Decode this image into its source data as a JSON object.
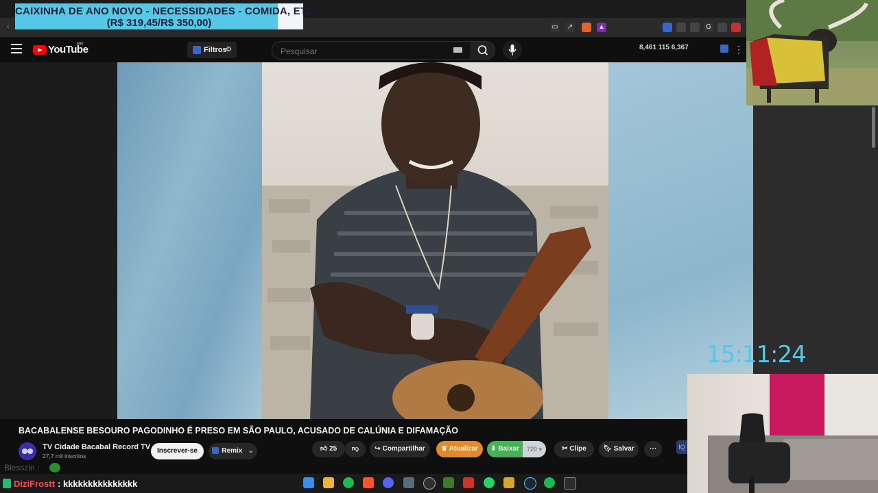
{
  "donation": {
    "title": "CAIXINHA DE ANO NOVO - NECESSIDADES - COMIDA, ETC.",
    "amount": "(R$ 319,45/R$ 350,00)",
    "progress_fraction": 0.913,
    "fill_color": "#57c7e6"
  },
  "youtube": {
    "logo_text": "YouTube",
    "country_code": "BR",
    "filters_label": "Filtros",
    "search_placeholder": "Pesquisar",
    "stats": "8,461   115   6,367"
  },
  "video": {
    "title": "BACABALENSE BESOURO PAGODINHO É PRESO EM SÃO PAULO, ACUSADO DE CALÚNIA E DIFAMAÇÃO",
    "channel_name": "TV Cidade Bacabal Record TV",
    "channel_subs": "27,7 mil inscritos",
    "subscribe_label": "Inscrever-se",
    "remix_label": "Remix",
    "like_count": "25",
    "share_label": "Compartilhar",
    "update_label": "Atualizar",
    "download_label": "Baixar",
    "quality_label": "720",
    "clip_label": "Clipe",
    "save_label": "Salvar",
    "iq_label": "IQ"
  },
  "chat": [
    {
      "user": "Blesszin",
      "message": ":"
    },
    {
      "user": "DiziFrostt",
      "message": ": kkkkkkkkkkkkkkk"
    }
  ],
  "clock": "15:11:24",
  "icons": {
    "menu": "hamburger-icon",
    "search": "search-icon",
    "mic": "microphone-icon",
    "like": "thumbs-up-icon",
    "dislike": "thumbs-down-icon",
    "share": "share-arrow-icon",
    "clip": "scissors-icon",
    "save": "bookmark-icon",
    "more": "more-dots-icon"
  },
  "taskbar_apps": [
    "windows-start-icon",
    "file-explorer-icon",
    "spotify-icon",
    "brave-browser-icon",
    "discord-icon",
    "calculator-icon",
    "obs-icon",
    "nvidia-icon",
    "brave-shield-icon",
    "whatsapp-icon",
    "app-icon",
    "steam-icon",
    "spotify-icon-2",
    "terminal-icon"
  ]
}
